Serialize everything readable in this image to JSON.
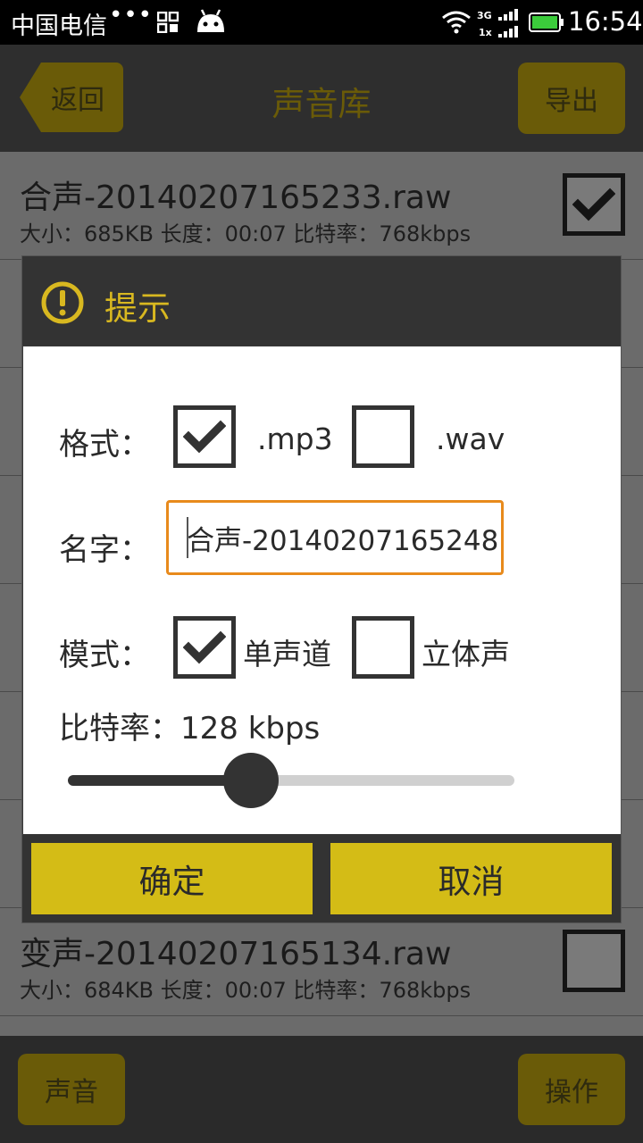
{
  "status_bar": {
    "carrier": "中国电信",
    "dots": "•••",
    "time": "16:54",
    "net_type_top": "3G",
    "net_type_bottom": "1x"
  },
  "header": {
    "back_label": "返回",
    "title": "声音库",
    "export_label": "导出"
  },
  "list": {
    "items": [
      {
        "name": "合声-20140207165233.raw",
        "meta": "大小：685KB 长度：00:07 比特率：768kbps",
        "checked": true
      },
      {
        "name": "变声-20140207165134.raw",
        "meta": "大小：684KB 长度：00:07 比特率：768kbps",
        "checked": false
      }
    ]
  },
  "bottom_bar": {
    "sound_label": "声音",
    "action_label": "操作"
  },
  "dialog": {
    "title": "提示",
    "format_label": "格式：",
    "format_options": [
      {
        "label": ".mp3",
        "checked": true
      },
      {
        "label": ".wav",
        "checked": false
      }
    ],
    "name_label": "名字：",
    "name_value": "合声-20140207165248",
    "mode_label": "模式：",
    "mode_options": [
      {
        "label": "单声道",
        "checked": true
      },
      {
        "label": "立体声",
        "checked": false
      }
    ],
    "bitrate_label": "比特率：128 kbps",
    "bitrate_slider_fraction": 0.41,
    "confirm_label": "确定",
    "cancel_label": "取消"
  },
  "colors": {
    "accent_yellow": "#d4bc16",
    "title_yellow": "#d8b820",
    "input_focus_orange": "#e88a1c"
  }
}
